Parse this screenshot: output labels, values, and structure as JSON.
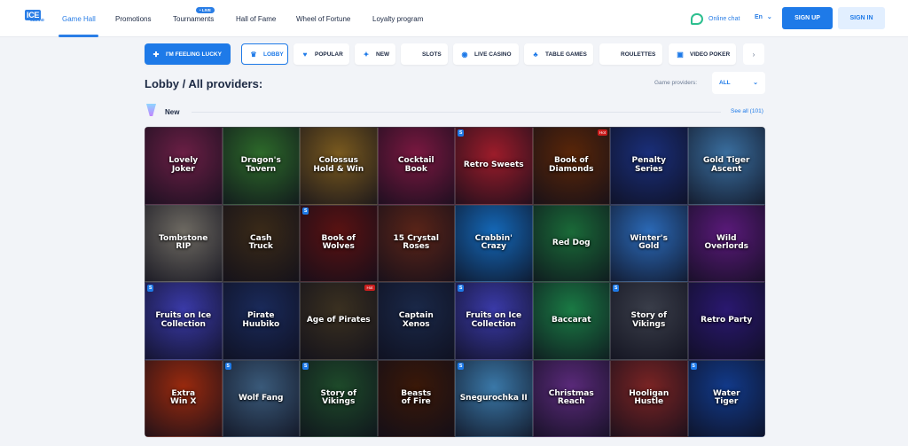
{
  "logo": {
    "ice": "ICE",
    "casino": "casino"
  },
  "nav": {
    "items": [
      {
        "label": "Game Hall",
        "active": true
      },
      {
        "label": "Promotions"
      },
      {
        "label": "Tournaments",
        "badge": "• LIVE"
      },
      {
        "label": "Hall of Fame"
      },
      {
        "label": "Wheel of Fortune"
      },
      {
        "label": "Loyalty program"
      }
    ],
    "online_chat": "Online chat",
    "language": "En",
    "sign_up": "SIGN UP",
    "sign_in": "SIGN IN"
  },
  "categories": [
    {
      "label": "I'M FEELING LUCKY",
      "icon": "clover-icon"
    },
    {
      "label": "LOBBY",
      "icon": "trophy-icon",
      "active": true
    },
    {
      "label": "POPULAR",
      "icon": "heart-icon"
    },
    {
      "label": "NEW",
      "icon": "new-star-icon"
    },
    {
      "label": "SLOTS",
      "icon": "slot-icon"
    },
    {
      "label": "LIVE CASINO",
      "icon": "live-dot-icon"
    },
    {
      "label": "TABLE GAMES",
      "icon": "club-icon"
    },
    {
      "label": "ROULETTES",
      "icon": "roulette-icon"
    },
    {
      "label": "VIDEO POKER",
      "icon": "poker-icon"
    }
  ],
  "lobby": {
    "title": "Lobby / All providers:",
    "providers_label": "Game providers:",
    "providers_value": "ALL"
  },
  "section": {
    "title": "New",
    "see_all": "See all (101)"
  },
  "games": [
    {
      "name": "Lovely\nJoker",
      "bg": "#6b1f45"
    },
    {
      "name": "Dragon's\nTavern",
      "bg": "#2d6a2a"
    },
    {
      "name": "Colossus\nHold & Win",
      "bg": "#7a5a1e"
    },
    {
      "name": "Cocktail\nBook",
      "bg": "#7a1840"
    },
    {
      "name": "Retro Sweets",
      "bg": "#9c1c2a",
      "badge": "S"
    },
    {
      "name": "Book of Diamonds",
      "bg": "#5a2608",
      "tag": "Hot"
    },
    {
      "name": "Penalty\nSeries",
      "bg": "#1a2f7a"
    },
    {
      "name": "Gold Tiger\nAscent",
      "bg": "#3a6fa0"
    },
    {
      "name": "Tombstone\nRIP",
      "bg": "#6e6a62"
    },
    {
      "name": "Cash\nTruck",
      "bg": "#3a2a18"
    },
    {
      "name": "Book of\nWolves",
      "bg": "#5a1212",
      "badge": "S"
    },
    {
      "name": "15 Crystal Roses",
      "bg": "#5a2418"
    },
    {
      "name": "Crabbin'\nCrazy",
      "bg": "#1468b8"
    },
    {
      "name": "Red Dog",
      "bg": "#1a6a38"
    },
    {
      "name": "Winter's\nGold",
      "bg": "#2b6ab8"
    },
    {
      "name": "Wild\nOverlords",
      "bg": "#5a1a7a"
    },
    {
      "name": "Fruits on Ice\nCollection",
      "bg": "#3a3aa8",
      "badge": "S"
    },
    {
      "name": "Pirate\nHuubiko",
      "bg": "#1a2a5a"
    },
    {
      "name": "Age of Pirates",
      "bg": "#3a3020",
      "tag": "Hot"
    },
    {
      "name": "Captain\nXenos",
      "bg": "#1a2848"
    },
    {
      "name": "Fruits on Ice\nCollection",
      "bg": "#3a3aa8",
      "badge": "S"
    },
    {
      "name": "Baccarat",
      "bg": "#1a7a44"
    },
    {
      "name": "Story of Vikings",
      "bg": "#3a3e4a",
      "badge": "S"
    },
    {
      "name": "Retro Party",
      "bg": "#2a1870"
    },
    {
      "name": "Extra\nWin X",
      "bg": "#9a2a0e"
    },
    {
      "name": "Wolf Fang",
      "bg": "#3a5a7a",
      "badge": "S"
    },
    {
      "name": "Story of Vikings",
      "bg": "#1e4a2a",
      "badge": "S"
    },
    {
      "name": "Beasts\nof Fire",
      "bg": "#3a1808"
    },
    {
      "name": "Snegurochka II",
      "bg": "#3a78a8",
      "badge": "S"
    },
    {
      "name": "Christmas\nReach",
      "bg": "#5a2a7a"
    },
    {
      "name": "Hooligan\nHustle",
      "bg": "#7a2424"
    },
    {
      "name": "Water\nTiger",
      "bg": "#123a8a",
      "badge": "S"
    }
  ]
}
